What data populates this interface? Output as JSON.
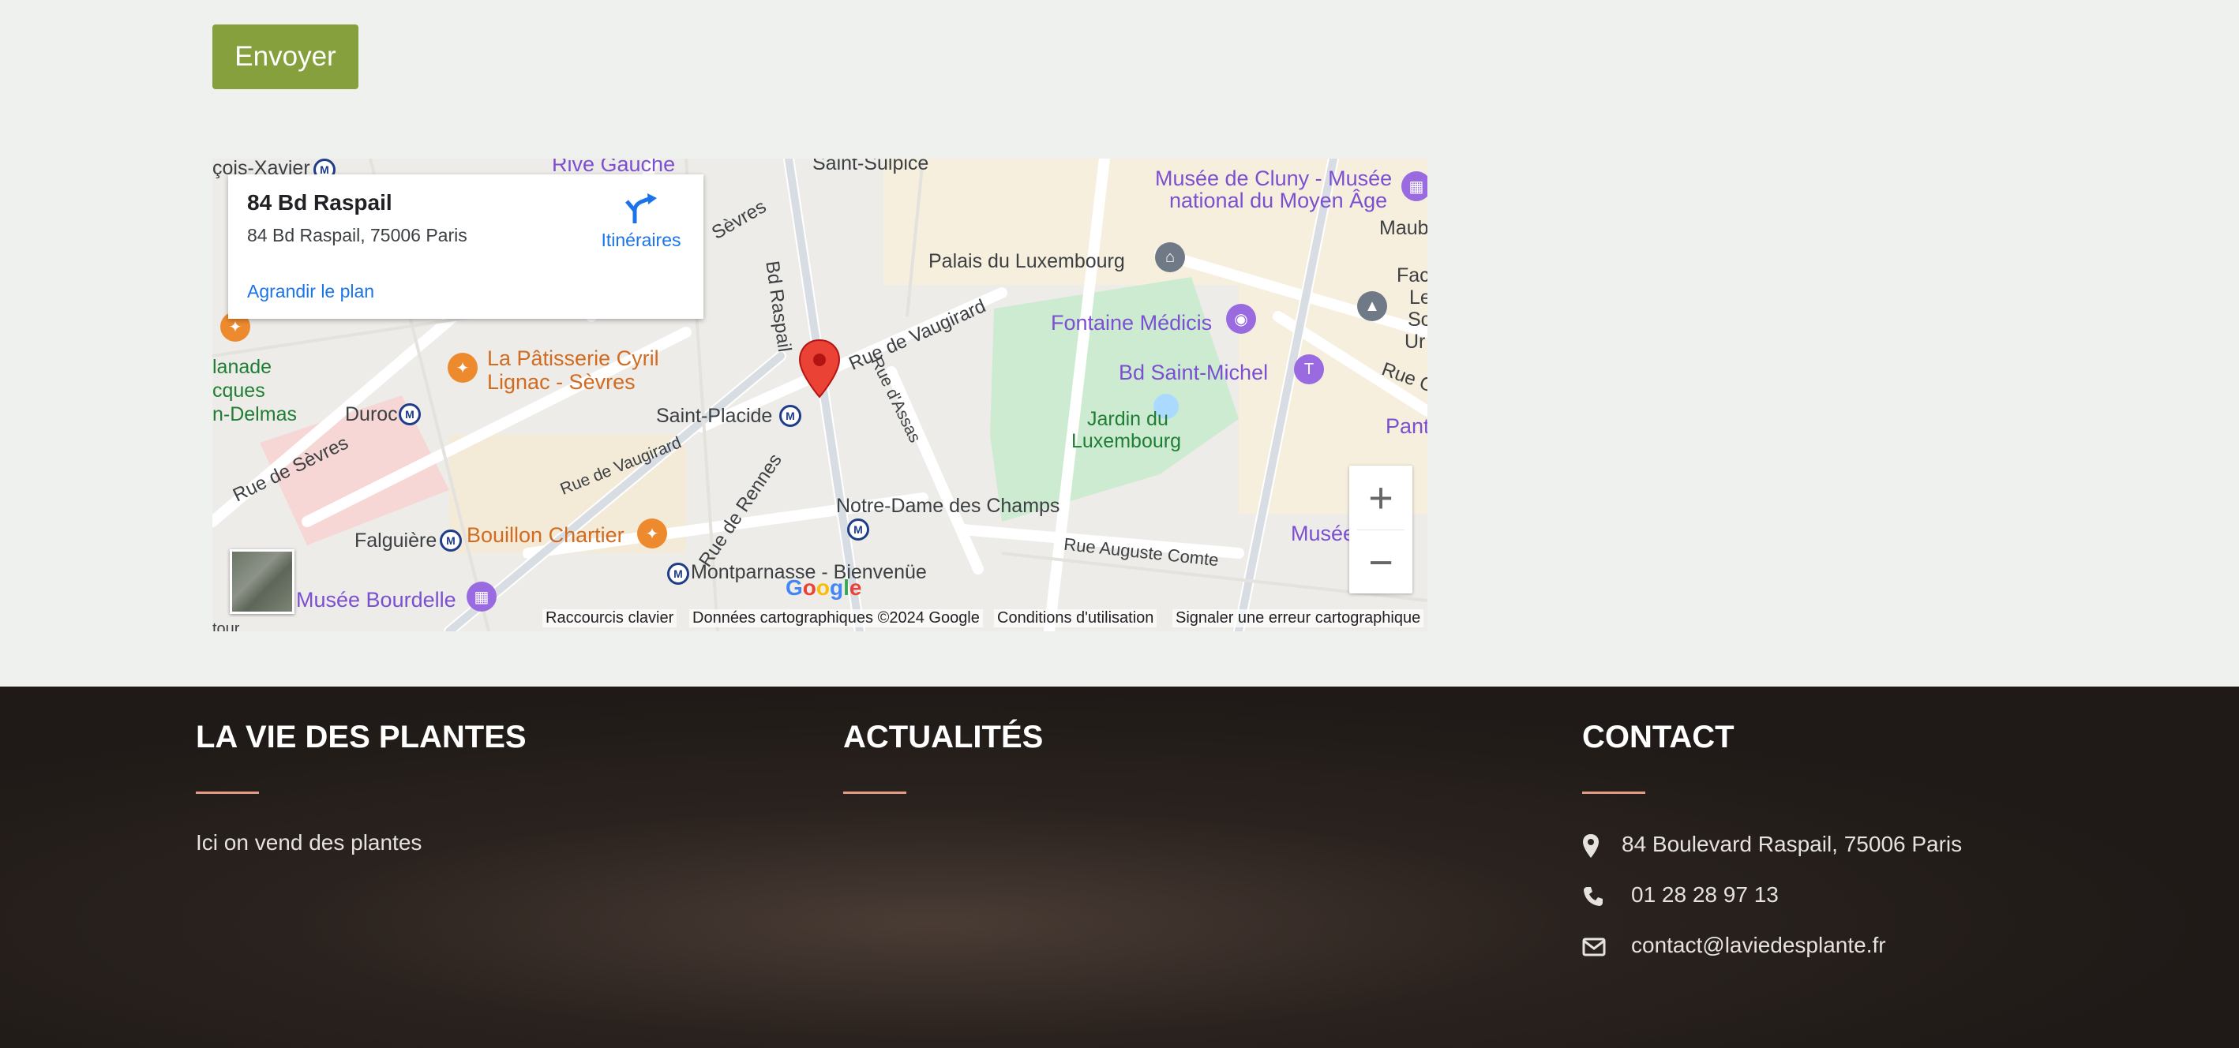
{
  "form": {
    "send_label": "Envoyer"
  },
  "map": {
    "info_title": "84 Bd Raspail",
    "info_address": "84 Bd Raspail, 75006 Paris",
    "directions_label": "Itinéraires",
    "enlarge_label": "Agrandir le plan",
    "zoom_in": "+",
    "zoom_out": "−",
    "google_logo": "Google",
    "attribution": [
      "Raccourcis clavier",
      "Données cartographiques ©2024 Google",
      "Conditions d'utilisation",
      "Signaler une erreur cartographique"
    ],
    "places": {
      "st_francois_xavier": "çois-Xavier",
      "rive_gauche": "Rive Gauche",
      "saint_sulpice": "Saint-Sulpice",
      "cluny_1": "Musée de Cluny - Musée",
      "cluny_2": "national du Moyen Âge",
      "maub": "Maub",
      "palais_lux": "Palais du Luxembourg",
      "fontaine": "Fontaine Médicis",
      "bd_st_michel": "Bd Saint-Michel",
      "jardin_1": "Jardin du",
      "jardin_2": "Luxembourg",
      "patisserie_1": "La Pâtisserie Cyril",
      "patisserie_2": "Lignac - Sèvres",
      "esplanade_1": "lanade",
      "esplanade_2": "cques",
      "esplanade_3": "n-Delmas",
      "duroc": "Duroc",
      "saint_placide": "Saint-Placide",
      "notre_dame": "Notre-Dame des Champs",
      "falguiere": "Falguière",
      "bouillon": "Bouillon Chartier",
      "montparnasse": "Montparnasse - Bienvenüe",
      "bourdelle": "Musée Bourdelle",
      "musee_right": "Musée",
      "fac_1": "Fac",
      "fac_2": "Le",
      "fac_3": "So",
      "fac_4": "Ur",
      "panth": "Pant",
      "tour": "tour"
    },
    "streets": {
      "bd_raspail": "Bd Raspail",
      "rue_sevres_top": "Sèvres",
      "rue_vaugirard": "Rue de Vaugirard",
      "rue_assas": "Rue d'Assas",
      "rue_sevres": "Rue de Sèvres",
      "rue_vaugirard_2": "Rue de Vaugirard",
      "rue_rennes": "Rue de Rennes",
      "rue_auguste_comte": "Rue Auguste Comte",
      "rue_c": "Rue C"
    }
  },
  "footer": {
    "col1_title": "LA VIE DES PLANTES",
    "col1_text": "Ici on vend des plantes",
    "col2_title": "ACTUALITÉS",
    "col3_title": "CONTACT",
    "address": "84 Boulevard Raspail, 75006 Paris",
    "phone": "01 28 28 97 13",
    "email": "contact@laviedesplante.fr"
  }
}
